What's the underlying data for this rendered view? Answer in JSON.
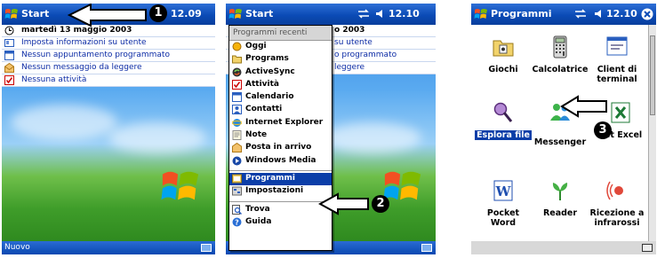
{
  "screen1": {
    "title": "Start",
    "time": "12.09",
    "date": "martedì 13 maggio 2003",
    "items": [
      {
        "label": "Imposta informazioni su utente",
        "icon": "user-card-icon"
      },
      {
        "label": "Nessun appuntamento programmato",
        "icon": "calendar-icon"
      },
      {
        "label": "Nessun messaggio da leggere",
        "icon": "envelope-icon"
      },
      {
        "label": "Nessuna attività",
        "icon": "task-icon"
      }
    ],
    "menubar_left": "Nuovo",
    "step_badge": "1"
  },
  "screen2": {
    "title": "Start",
    "time": "12.10",
    "menu_header": "Programmi recenti",
    "items": [
      {
        "label": "Oggi",
        "icon": "today-icon"
      },
      {
        "label": "Programs",
        "icon": "folder-icon"
      },
      {
        "label": "ActiveSync",
        "icon": "activesync-icon"
      },
      {
        "label": "Attività",
        "icon": "task-icon"
      },
      {
        "label": "Calendario",
        "icon": "calendar-icon"
      },
      {
        "label": "Contatti",
        "icon": "contacts-icon"
      },
      {
        "label": "Internet Explorer",
        "icon": "ie-icon"
      },
      {
        "label": "Note",
        "icon": "note-icon"
      },
      {
        "label": "Posta in arrivo",
        "icon": "inbox-icon"
      },
      {
        "label": "Windows Media",
        "icon": "media-icon"
      }
    ],
    "items2": [
      {
        "label": "Programmi",
        "icon": "programs-icon",
        "selected": true
      },
      {
        "label": "Impostazioni",
        "icon": "settings-icon"
      }
    ],
    "items3": [
      {
        "label": "Trova",
        "icon": "find-icon"
      },
      {
        "label": "Guida",
        "icon": "help-icon"
      }
    ],
    "today_behind": [
      "o 2003",
      "su utente",
      "o programmato",
      "leggere"
    ],
    "step_badge": "2"
  },
  "screen3": {
    "title": "Programmi",
    "time": "12.10",
    "items": [
      {
        "label": "Giochi",
        "icon": "games-folder-icon"
      },
      {
        "label": "Calcolatrice",
        "icon": "calculator-icon"
      },
      {
        "label": "Client di terminal",
        "icon": "terminal-client-icon"
      },
      {
        "label": "Esplora file",
        "icon": "file-explorer-icon",
        "selected": true
      },
      {
        "label": "Messenger",
        "icon": "messenger-icon"
      },
      {
        "label": "Pocket Excel",
        "icon": "excel-icon",
        "visible_label": "ket Excel"
      },
      {
        "label": "Pocket Word",
        "icon": "word-icon"
      },
      {
        "label": "Reader",
        "icon": "reader-icon"
      },
      {
        "label": "Ricezione a infrarossi",
        "icon": "infrared-icon"
      }
    ],
    "step_badge": "3"
  },
  "colors": {
    "titlebar": "#0b4bb6",
    "selection": "#0b3ea8",
    "today_text": "#0c2ba5"
  }
}
